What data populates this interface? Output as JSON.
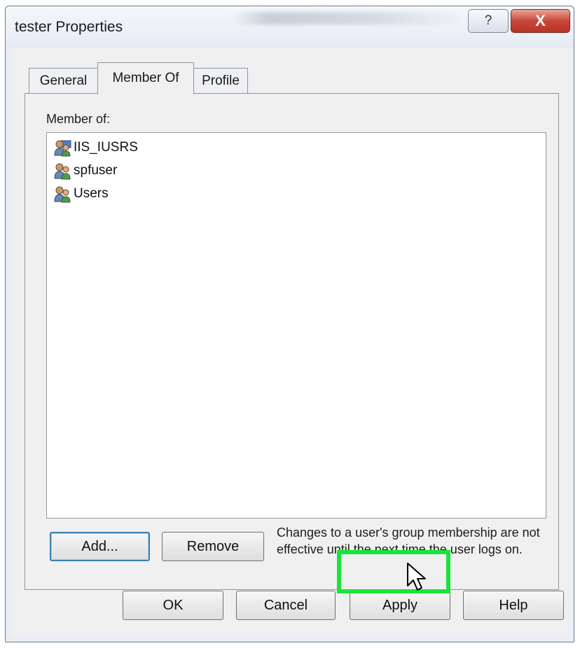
{
  "window": {
    "title": "tester Properties",
    "help_glyph": "?",
    "close_glyph": "X"
  },
  "tabs": [
    {
      "label": "General",
      "active": false
    },
    {
      "label": "Member Of",
      "active": true
    },
    {
      "label": "Profile",
      "active": false
    }
  ],
  "member_of": {
    "label": "Member of:",
    "groups": [
      {
        "name": "IIS_IUSRS",
        "icon": "group-icon"
      },
      {
        "name": "spfuser",
        "icon": "group-icon"
      },
      {
        "name": "Users",
        "icon": "group-icon"
      }
    ],
    "add_label": "Add...",
    "remove_label": "Remove",
    "note": "Changes to a user's group membership are not effective until the next time the user logs on."
  },
  "footer": {
    "ok_label": "OK",
    "cancel_label": "Cancel",
    "apply_label": "Apply",
    "help_label": "Help"
  },
  "colors": {
    "highlight": "#19e43a",
    "close_button": "#c7473a"
  }
}
